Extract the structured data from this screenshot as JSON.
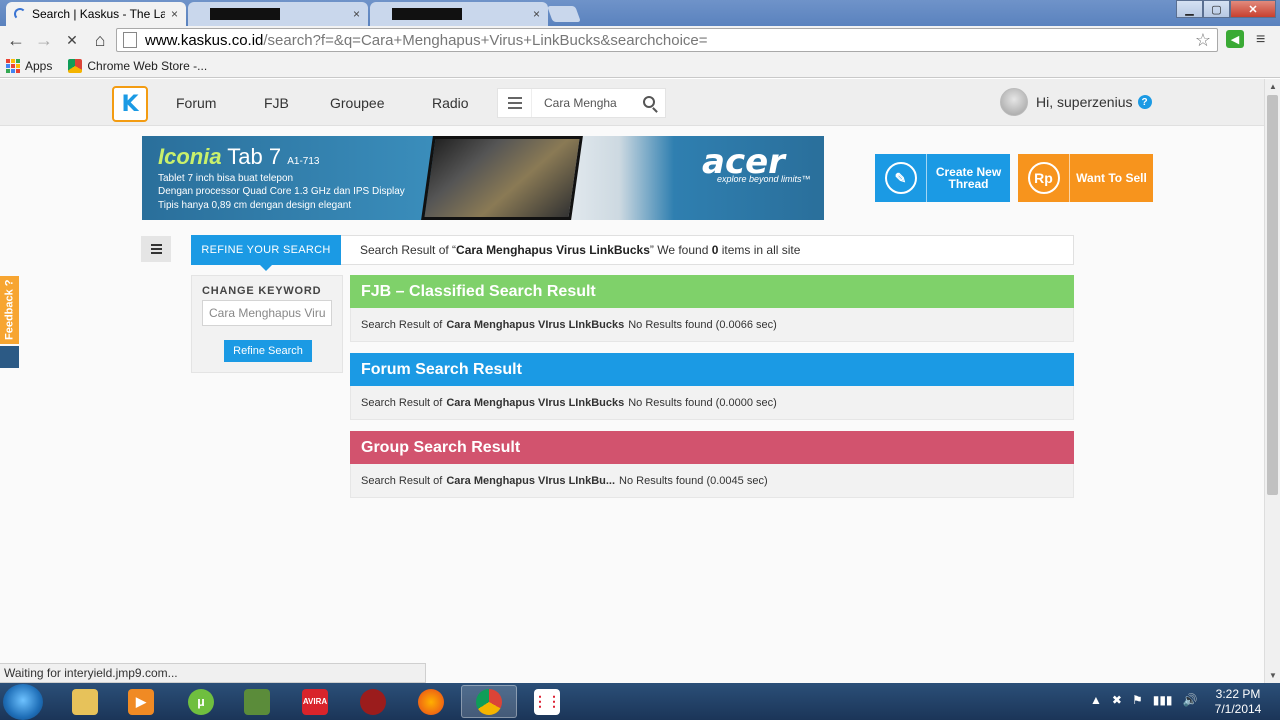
{
  "browser": {
    "tabs": [
      {
        "title": "Search | Kaskus - The Larg",
        "close": "×"
      },
      {
        "title": "",
        "close": "×"
      },
      {
        "title": "",
        "close": "×"
      }
    ],
    "window_controls": {
      "minimize": "▁",
      "maximize": "▢",
      "close": "✕"
    },
    "nav": {
      "back": "←",
      "forward": "→",
      "stop": "✕",
      "home": "⌂"
    },
    "url": {
      "host": "www.kaskus.co.id",
      "path": "/search?f=&q=Cara+Menghapus+Virus+LinkBucks&searchchoice="
    },
    "star": "☆",
    "menu": "≡",
    "bookmarks": [
      {
        "label": "Apps"
      },
      {
        "label": "Chrome Web Store -..."
      }
    ]
  },
  "site": {
    "logo": "K",
    "nav": [
      "Forum",
      "FJB",
      "Groupee",
      "Radio"
    ],
    "search_value": "Cara Mengha",
    "greeting": "Hi, superzenius",
    "help": "?"
  },
  "banner": {
    "series": "Iconia",
    "tab": " Tab 7",
    "model": "A1-713",
    "lines": [
      "Tablet 7 inch bisa buat telepon",
      "Dengan processor Quad Core 1.3 GHz dan IPS Display",
      "Tipis hanya 0,89 cm dengan design elegant"
    ],
    "brand": "acer",
    "tagline": "explore beyond limits™"
  },
  "actions": {
    "create_label": "Create New Thread",
    "sell_label": "Want To Sell",
    "sell_icon": "Rp",
    "create_icon": "✎"
  },
  "feedback": "Feedback ?",
  "search": {
    "refine_tab": "REFINE YOUR SEARCH",
    "summary_prefix": "Search Result of “",
    "keyword": "Cara Menghapus Virus LinkBucks",
    "summary_middle": "” We found ",
    "count": "0",
    "summary_suffix": " items in all site",
    "change_keyword": "CHANGE KEYWORD",
    "keyword_input": "Cara Menghapus Virus",
    "refine_button": "Refine Search"
  },
  "results": [
    {
      "title": "FJB – Classified Search Result",
      "prefix": "Search Result of",
      "keyword": "Cara Menghapus VIrus LInkBucks",
      "note": " No Results found (0.0066 sec)"
    },
    {
      "title": "Forum Search Result",
      "prefix": "Search Result of",
      "keyword": "Cara Menghapus VIrus LInkBucks",
      "note": "No Results found (0.0000 sec)"
    },
    {
      "title": "Group Search Result",
      "prefix": "Search Result of",
      "keyword": "Cara Menghapus VIrus LInkBu...",
      "note": "No Results found (0.0045 sec)"
    }
  ],
  "status": "Waiting for interyield.jmp9.com...",
  "taskbar": {
    "clock_time": "3:22 PM",
    "clock_date": "7/1/2014",
    "tray": [
      "▲",
      "✖",
      "⚑",
      "▮▮▮",
      "🔊"
    ]
  },
  "colors": {
    "kaskus_blue": "#1b9ae4",
    "fjb_green": "#7fd16a",
    "group_pink": "#d2536e",
    "sell_orange": "#f7941d"
  }
}
